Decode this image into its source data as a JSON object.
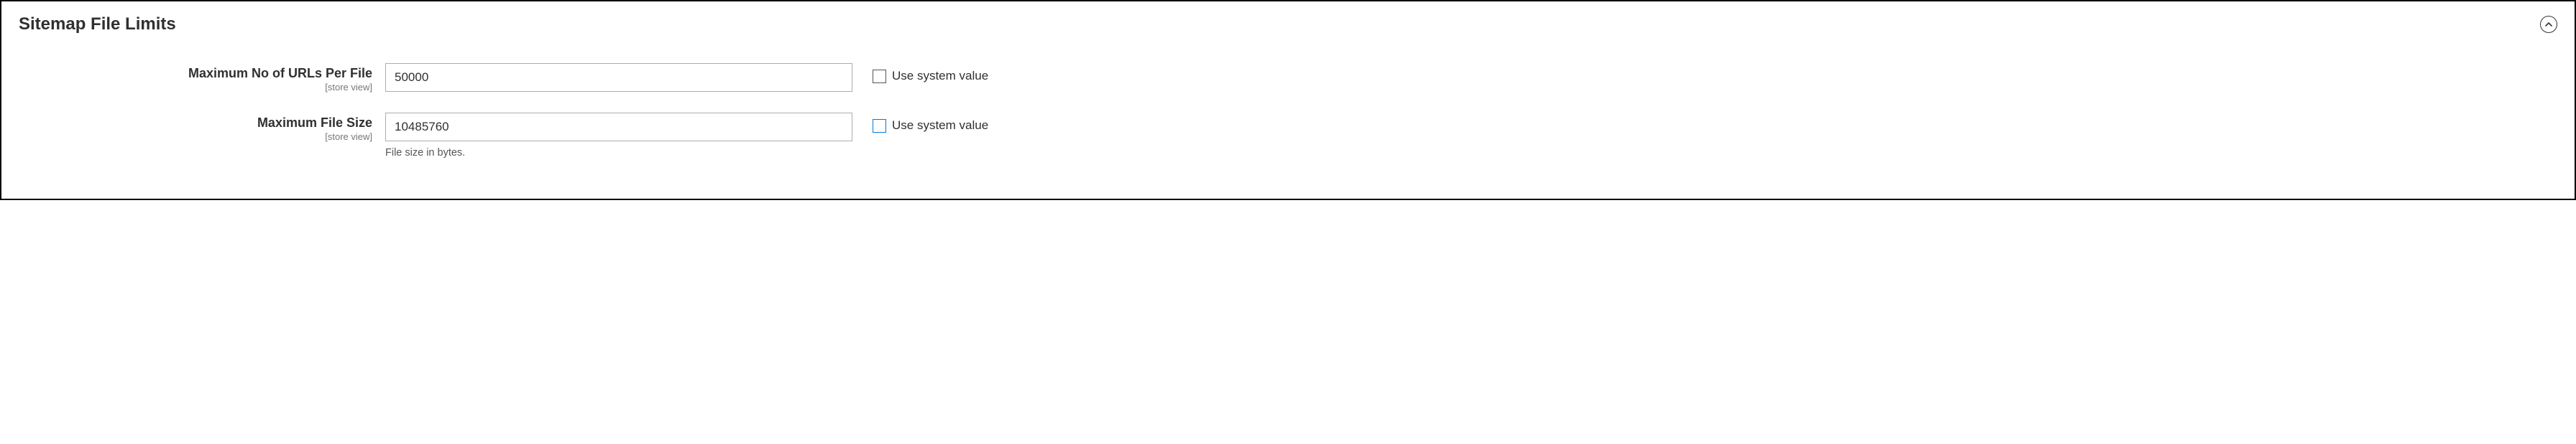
{
  "section": {
    "title": "Sitemap File Limits"
  },
  "fields": {
    "max_urls": {
      "label": "Maximum No of URLs Per File",
      "scope": "[store view]",
      "value": "50000",
      "use_system_label": "Use system value"
    },
    "max_size": {
      "label": "Maximum File Size",
      "scope": "[store view]",
      "value": "10485760",
      "note": "File size in bytes.",
      "use_system_label": "Use system value"
    }
  }
}
